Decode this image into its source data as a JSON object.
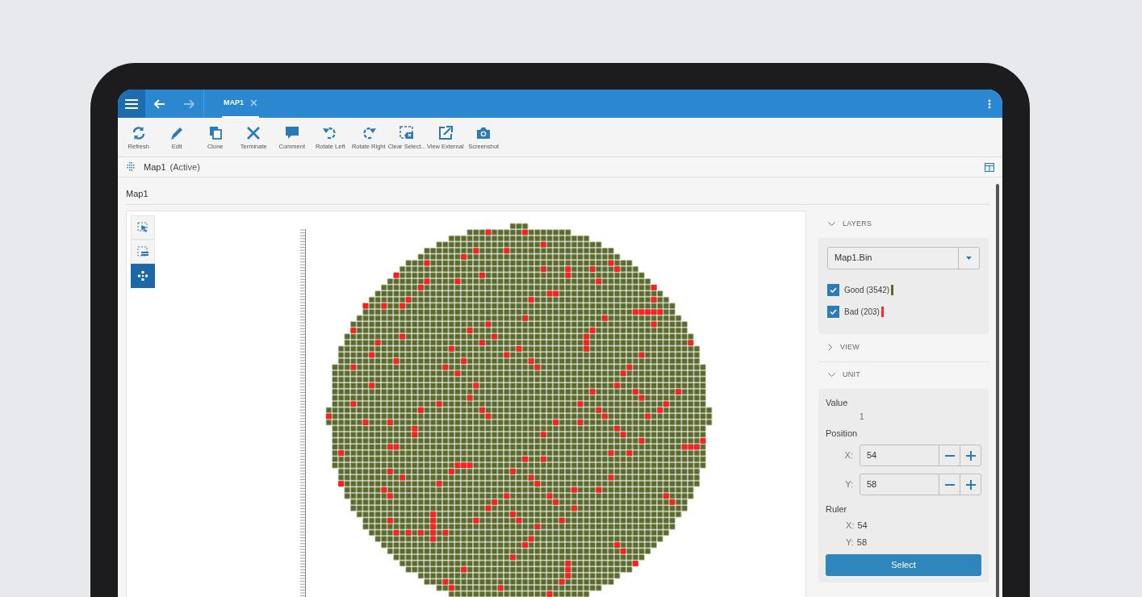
{
  "header": {
    "tabs": [
      {
        "label": "MAP1",
        "selected": true
      }
    ]
  },
  "toolbar": [
    {
      "label": "Refresh",
      "kind": "refresh"
    },
    {
      "label": "Edit",
      "kind": "edit"
    },
    {
      "label": "Clone",
      "kind": "clone"
    },
    {
      "label": "Terminate",
      "kind": "terminate"
    },
    {
      "label": "Comment",
      "kind": "comment"
    },
    {
      "label": "Rotate Left",
      "kind": "rotateleft"
    },
    {
      "label": "Rotate Right",
      "kind": "rotateright"
    },
    {
      "label": "Clear Select...",
      "kind": "clear"
    },
    {
      "label": "View External",
      "kind": "external"
    },
    {
      "label": "Screenshot",
      "kind": "camera"
    }
  ],
  "breadcrumb": {
    "title": "Map1",
    "status": "(Active)"
  },
  "section_title": "Map1",
  "map_tools": [
    {
      "kind": "select",
      "selected": false
    },
    {
      "kind": "listselect",
      "selected": false
    },
    {
      "kind": "move",
      "selected": true
    }
  ],
  "layers": {
    "title": "LAYERS",
    "expanded": true,
    "dropdown": "Map1.Bin",
    "items": [
      {
        "label": "Good (3542)",
        "checked": true,
        "color": "#5a6a2c"
      },
      {
        "label": "Bad (203)",
        "checked": true,
        "color": "#ff2a2a"
      }
    ]
  },
  "view": {
    "title": "VIEW",
    "expanded": false
  },
  "unit": {
    "title": "UNIT",
    "expanded": true,
    "value_label": "Value",
    "value": "1",
    "position_label": "Position",
    "position": [
      {
        "axis": "X:",
        "value": "54"
      },
      {
        "axis": "Y:",
        "value": "58"
      }
    ],
    "ruler_label": "Ruler",
    "ruler": [
      {
        "axis": "X:",
        "value": "54"
      },
      {
        "axis": "Y:",
        "value": "58"
      }
    ],
    "button": "Select"
  }
}
